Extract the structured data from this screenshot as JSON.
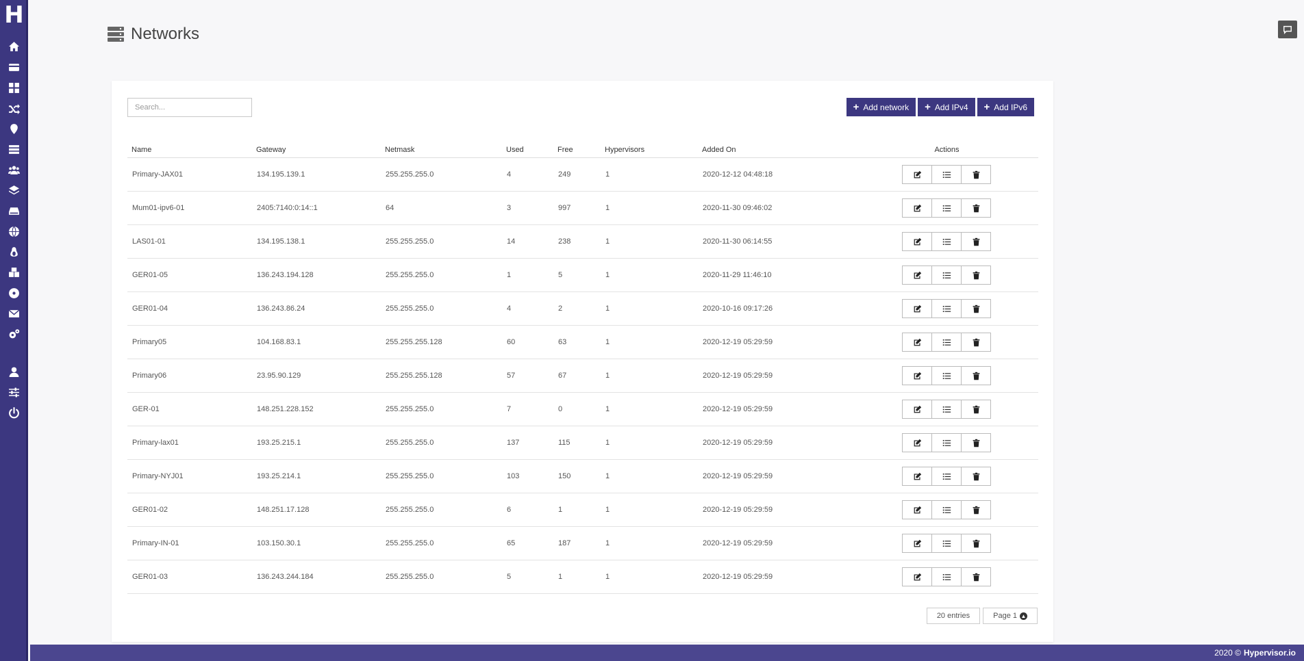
{
  "app": {
    "logo_letter": "H"
  },
  "sidebar": {
    "items": [
      {
        "icon": "home-icon"
      },
      {
        "icon": "card-icon"
      },
      {
        "icon": "dashboard-grid-icon"
      },
      {
        "icon": "shuffle-icon"
      },
      {
        "icon": "map-marker-icon"
      },
      {
        "icon": "server-icon"
      },
      {
        "icon": "users-icon"
      },
      {
        "icon": "layers-icon"
      },
      {
        "icon": "hard-drive-icon"
      },
      {
        "icon": "globe-icon"
      },
      {
        "icon": "linux-icon"
      },
      {
        "icon": "boxes-icon"
      },
      {
        "icon": "disc-icon"
      },
      {
        "icon": "envelope-icon"
      },
      {
        "icon": "cogs-icon"
      },
      {
        "icon": "user-icon"
      },
      {
        "icon": "sliders-icon"
      },
      {
        "icon": "power-icon"
      }
    ]
  },
  "header": {
    "title": "Networks",
    "icon": "server-stack-icon"
  },
  "search": {
    "placeholder": "Search..."
  },
  "toolbar": {
    "add_network": "Add network",
    "add_ipv4": "Add IPv4",
    "add_ipv6": "Add IPv6"
  },
  "table": {
    "columns": [
      "Name",
      "Gateway",
      "Netmask",
      "Used",
      "Free",
      "Hypervisors",
      "Added On",
      "Actions"
    ],
    "rows": [
      {
        "name": "Primary-JAX01",
        "gateway": "134.195.139.1",
        "netmask": "255.255.255.0",
        "used": "4",
        "free": "249",
        "hypervisors": "1",
        "added": "2020-12-12 04:48:18"
      },
      {
        "name": "Mum01-ipv6-01",
        "gateway": "2405:7140:0:14::1",
        "netmask": "64",
        "used": "3",
        "free": "997",
        "hypervisors": "1",
        "added": "2020-11-30 09:46:02"
      },
      {
        "name": "LAS01-01",
        "gateway": "134.195.138.1",
        "netmask": "255.255.255.0",
        "used": "14",
        "free": "238",
        "hypervisors": "1",
        "added": "2020-11-30 06:14:55"
      },
      {
        "name": "GER01-05",
        "gateway": "136.243.194.128",
        "netmask": "255.255.255.0",
        "used": "1",
        "free": "5",
        "hypervisors": "1",
        "added": "2020-11-29 11:46:10"
      },
      {
        "name": "GER01-04",
        "gateway": "136.243.86.24",
        "netmask": "255.255.255.0",
        "used": "4",
        "free": "2",
        "hypervisors": "1",
        "added": "2020-10-16 09:17:26"
      },
      {
        "name": "Primary05",
        "gateway": "104.168.83.1",
        "netmask": "255.255.255.128",
        "used": "60",
        "free": "63",
        "hypervisors": "1",
        "added": "2020-12-19 05:29:59"
      },
      {
        "name": "Primary06",
        "gateway": "23.95.90.129",
        "netmask": "255.255.255.128",
        "used": "57",
        "free": "67",
        "hypervisors": "1",
        "added": "2020-12-19 05:29:59"
      },
      {
        "name": "GER-01",
        "gateway": "148.251.228.152",
        "netmask": "255.255.255.0",
        "used": "7",
        "free": "0",
        "hypervisors": "1",
        "added": "2020-12-19 05:29:59"
      },
      {
        "name": "Primary-lax01",
        "gateway": "193.25.215.1",
        "netmask": "255.255.255.0",
        "used": "137",
        "free": "115",
        "hypervisors": "1",
        "added": "2020-12-19 05:29:59"
      },
      {
        "name": "Primary-NYJ01",
        "gateway": "193.25.214.1",
        "netmask": "255.255.255.0",
        "used": "103",
        "free": "150",
        "hypervisors": "1",
        "added": "2020-12-19 05:29:59"
      },
      {
        "name": "GER01-02",
        "gateway": "148.251.17.128",
        "netmask": "255.255.255.0",
        "used": "6",
        "free": "1",
        "hypervisors": "1",
        "added": "2020-12-19 05:29:59"
      },
      {
        "name": "Primary-IN-01",
        "gateway": "103.150.30.1",
        "netmask": "255.255.255.0",
        "used": "65",
        "free": "187",
        "hypervisors": "1",
        "added": "2020-12-19 05:29:59"
      },
      {
        "name": "GER01-03",
        "gateway": "136.243.244.184",
        "netmask": "255.255.255.0",
        "used": "5",
        "free": "1",
        "hypervisors": "1",
        "added": "2020-12-19 05:29:59"
      }
    ]
  },
  "pagination": {
    "entries": "20 entries",
    "page": "Page 1"
  },
  "footer": {
    "year": "2020 ©",
    "brand": "Hypervisor.io"
  },
  "colors": {
    "primary": "#3c3780",
    "footer": "#4b468f"
  }
}
